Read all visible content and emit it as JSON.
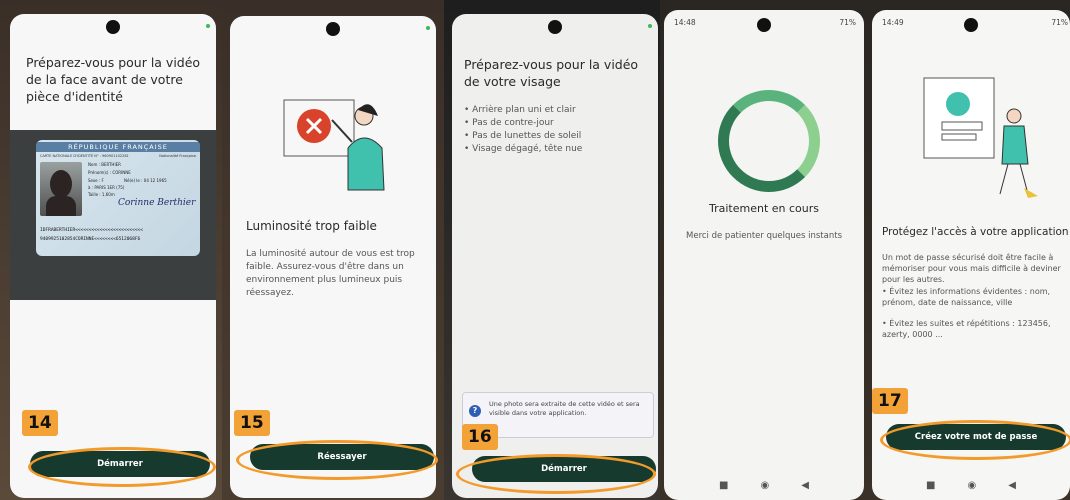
{
  "screens": [
    {
      "step": "14",
      "title": "Préparez-vous pour la vidéo de la face avant de votre pièce d'identité",
      "button": "Démarrer",
      "id_card": {
        "header": "RÉPUBLIQUE FRANÇAISE",
        "card_label": "CARTE NATIONALE D'IDENTITÉ N° : 960901102281",
        "nationality": "Nationalité Française",
        "nom": "Nom : BERTHIER",
        "prenoms": "Prénom(s) : CORINNE",
        "sexe": "Sexe : F",
        "ne_le": "Né(e) le : 04 12 1965",
        "lieu": "à : PARIS 1ER (75)",
        "taille": "Taille : 1,60m",
        "signature": "Corinne Berthier",
        "mrz1": "IDFRABERTHIER<<<<<<<<<<<<<<<<<<<<<<<<<",
        "mrz2": "9409925102854CORINNE<<<<<<<<6512068F6"
      }
    },
    {
      "step": "15",
      "title": "Luminosité trop faible",
      "body": "La luminosité autour de vous est trop faible. Assurez-vous d'être dans un environnement plus lumineux puis réessayez.",
      "button": "Réessayer"
    },
    {
      "step": "16",
      "title": "Préparez-vous pour la vidéo de votre visage",
      "bullets": [
        "Arrière plan uni et clair",
        "Pas de contre-jour",
        "Pas de lunettes de soleil",
        "Visage dégagé, tête nue"
      ],
      "info": "Une photo sera extraite de cette vidéo et sera visible dans votre application.",
      "button": "Démarrer"
    },
    {
      "time": "14:48",
      "battery": "71%",
      "title": "Traitement en cours",
      "body": "Merci de patienter quelques instants"
    },
    {
      "step": "17",
      "time": "14:49",
      "battery": "71%",
      "title": "Protégez l'accès à votre application",
      "body": "Un mot de passe sécurisé doit être facile à mémoriser pour vous mais difficile à deviner pour les autres.",
      "tips": [
        "• Évitez les informations évidentes : nom, prénom, date de naissance, ville",
        "• Évitez les suites et répétitions : 123456, azerty, 0000 ..."
      ],
      "button": "Créez votre mot de passe"
    }
  ],
  "colors": {
    "cta": "#173a2f",
    "highlight": "#f29a2a",
    "accent_green": "#33a89a",
    "alert_red": "#d9432b"
  },
  "icons": [
    "warning-illustration",
    "id-card-icon",
    "info-icon",
    "progress-ring",
    "security-illustration"
  ]
}
